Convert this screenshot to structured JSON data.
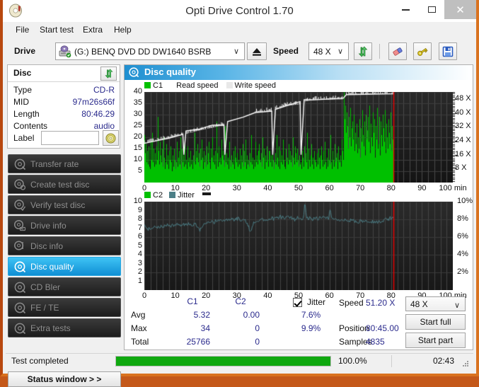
{
  "window": {
    "title": "Opti Drive Control 1.70",
    "icon": "disc-icon",
    "minimize_label": "–",
    "maximize_label": "□",
    "close_label": "✕"
  },
  "menu": {
    "items": [
      {
        "label": "File"
      },
      {
        "label": "Start test"
      },
      {
        "label": "Extra"
      },
      {
        "label": "Help"
      }
    ]
  },
  "toolbar": {
    "drive_label": "Drive",
    "drive_value": "(G:)   BENQ DVD DD DW1640 BSRB",
    "drive_icon": "drive-icon",
    "eject_icon": "eject-icon",
    "speed_label": "Speed",
    "speed_value": "48 X",
    "refresh_icon": "refresh-arrows-icon",
    "erase_icon": "erase-icon",
    "keys_icon": "keys-icon",
    "save_icon": "floppy-save-icon",
    "chevron": "∨"
  },
  "disc_panel": {
    "header": "Disc",
    "refresh_icon": "refresh-arrows-icon",
    "rows": [
      {
        "key": "Type",
        "value": "CD-R"
      },
      {
        "key": "MID",
        "value": "97m26s66f"
      },
      {
        "key": "Length",
        "value": "80:46.29"
      },
      {
        "key": "Contents",
        "value": "audio"
      }
    ],
    "label_key": "Label",
    "label_value": "",
    "label_placeholder": "",
    "label_button_icon": "cd-disc-icon"
  },
  "nav": {
    "items": [
      {
        "label": "Transfer rate",
        "icon": "disc-scan-icon",
        "active": false
      },
      {
        "label": "Create test disc",
        "icon": "disc-create-icon",
        "active": false
      },
      {
        "label": "Verify test disc",
        "icon": "disc-verify-icon",
        "active": false
      },
      {
        "label": "Drive info",
        "icon": "drive-info-icon",
        "active": false
      },
      {
        "label": "Disc info",
        "icon": "disc-info-icon",
        "active": false
      },
      {
        "label": "Disc quality",
        "icon": "disc-quality-icon",
        "active": true
      },
      {
        "label": "CD Bler",
        "icon": "disc-bler-icon",
        "active": false
      },
      {
        "label": "FE / TE",
        "icon": "disc-fete-icon",
        "active": false
      },
      {
        "label": "Extra tests",
        "icon": "disc-extra-icon",
        "active": false
      }
    ],
    "status_window_label": "Status window > >"
  },
  "content": {
    "title": "Disc quality",
    "icon": "disc-quality-icon"
  },
  "stats": {
    "col_headers": [
      "C1",
      "C2"
    ],
    "row_labels": [
      "Avg",
      "Max",
      "Total"
    ],
    "c1": {
      "avg": "5.32",
      "max": "34",
      "total": "25766"
    },
    "c2": {
      "avg": "0.00",
      "max": "0",
      "total": "0"
    },
    "jitter": {
      "label": "Jitter",
      "checked": true,
      "avg": "7.6%",
      "max": "9.9%"
    },
    "speed_label": "Speed",
    "speed_value": "51.20 X",
    "position_label": "Position",
    "position_value": "80:45.00",
    "samples_label": "Samples",
    "samples_value": "4835",
    "speed_select_value": "48 X",
    "start_full_label": "Start full",
    "start_part_label": "Start part"
  },
  "statusbar": {
    "status_text": "Test completed",
    "progress_pct": "100.0%",
    "progress_value": 100,
    "elapsed": "02:43"
  },
  "colors": {
    "c1_green": "#00c000",
    "jitter_teal": "#4c7f87",
    "speed_white": "#ffffff",
    "marker_red": "#ee0000",
    "plot_bg": "#202020",
    "accent_blue": "#1f8fd0",
    "progress_green": "#0fa80f"
  },
  "chart_data": [
    {
      "type": "area",
      "name": "c1-chart",
      "title": "",
      "xlabel": "min",
      "ylabel": "",
      "x": [
        0,
        100
      ],
      "xlim": [
        0,
        100
      ],
      "xticks": [
        0,
        10,
        20,
        30,
        40,
        50,
        60,
        70,
        80,
        90,
        100
      ],
      "xtick_labels": [
        "0",
        "10",
        "20",
        "30",
        "40",
        "50",
        "60",
        "70",
        "80",
        "90",
        "100 min"
      ],
      "ylim": [
        0,
        40
      ],
      "yticks": [
        5,
        10,
        15,
        20,
        25,
        30,
        35,
        40
      ],
      "ytick_labels": [
        "5",
        "10",
        "15",
        "20",
        "25",
        "30",
        "35",
        "40"
      ],
      "y2lim": [
        0,
        52
      ],
      "y2ticks": [
        8,
        16,
        24,
        32,
        40,
        48
      ],
      "y2tick_labels": [
        "8 X",
        "16 X",
        "24 X",
        "32 X",
        "40 X",
        "48 X"
      ],
      "grid": true,
      "legend": [
        {
          "label": "C1",
          "color": "#00c000"
        },
        {
          "label": "Read speed",
          "color": "#ffffff"
        },
        {
          "label": "Write speed",
          "color": "#e8e8e8"
        }
      ],
      "legend_position": "top-left",
      "data_end_x": 80.75,
      "marker_x": 80.75,
      "series": [
        {
          "name": "C1",
          "color": "#00c000",
          "kind": "impulse-area",
          "x_start": 0,
          "x_end": 80.75,
          "values": [
            21,
            13,
            17,
            9,
            14,
            8,
            16,
            7,
            12,
            6,
            18,
            10,
            22,
            9,
            15,
            7,
            11,
            13,
            8,
            16,
            10,
            29,
            14,
            8,
            18,
            6,
            12,
            9,
            15,
            7,
            20,
            11,
            6,
            13,
            9,
            17,
            8,
            12,
            6,
            14,
            10,
            8,
            16,
            9,
            5,
            12,
            7,
            15,
            10,
            6,
            13,
            9,
            18,
            7,
            11,
            14,
            8,
            20,
            10,
            6,
            15,
            9,
            12,
            7,
            17,
            8,
            13,
            10,
            6,
            16,
            9,
            11,
            7,
            14,
            8,
            19,
            10,
            6,
            12,
            9,
            22,
            8,
            14,
            6,
            11,
            17,
            9,
            13,
            7,
            15,
            10,
            8,
            19,
            11,
            6,
            14,
            9,
            12,
            7,
            16,
            10,
            8,
            13,
            18,
            9,
            6,
            15,
            11,
            7,
            20,
            9,
            12,
            8,
            14,
            6,
            27,
            10,
            13,
            7,
            16,
            9,
            11,
            8,
            19,
            12,
            6,
            14,
            10,
            7,
            25,
            9,
            13,
            8,
            15,
            11,
            6,
            18,
            10,
            7,
            12,
            9,
            22,
            8,
            14,
            6,
            16,
            11,
            9,
            13,
            7,
            20,
            10,
            8,
            15,
            6,
            12,
            9,
            17,
            11,
            7,
            14,
            9,
            19,
            6,
            12,
            8,
            16,
            10,
            7,
            13,
            9,
            21,
            8,
            11,
            6,
            15,
            10,
            7,
            18,
            9,
            12,
            8,
            14,
            6,
            17,
            10,
            9,
            13,
            7,
            20,
            11,
            8,
            15,
            6,
            12,
            9,
            16,
            10,
            7,
            14,
            26,
            14,
            9,
            12,
            7,
            18,
            10,
            6,
            15,
            9,
            13,
            8,
            21,
            11,
            7,
            16,
            10,
            6,
            14,
            9,
            12,
            8,
            19,
            10,
            7,
            13,
            6,
            15,
            9,
            11,
            8,
            17,
            10,
            6,
            14,
            9,
            12,
            7,
            20,
            11,
            8,
            16,
            6,
            13,
            9,
            15,
            10,
            7,
            12,
            8,
            18,
            9,
            6,
            14,
            11,
            7,
            16,
            10,
            8,
            13,
            9,
            22,
            6,
            15,
            10,
            7,
            12,
            9,
            17,
            8,
            11,
            6,
            14,
            10,
            9,
            19,
            7,
            13,
            8,
            15,
            11,
            6,
            12,
            9,
            16,
            10,
            7,
            14,
            8,
            18,
            9,
            6,
            13,
            11,
            7,
            15,
            10,
            8,
            21,
            9,
            12,
            6,
            14,
            10,
            7,
            17,
            9,
            11,
            8,
            13,
            6,
            16,
            10,
            9,
            12,
            7,
            19,
            8,
            14,
            10,
            42,
            28,
            34,
            22,
            31,
            18,
            25,
            15,
            29,
            20,
            33,
            16,
            24,
            12,
            27,
            19,
            30,
            14,
            22,
            17,
            26,
            13,
            31,
            20,
            15,
            28,
            11,
            24,
            18,
            32,
            14,
            21,
            16,
            27,
            12,
            30,
            19,
            23,
            15,
            29,
            18,
            34,
            13,
            26,
            20,
            16,
            31,
            14,
            22,
            28,
            11,
            25,
            19,
            33,
            15,
            23,
            17,
            29,
            12,
            27,
            21,
            16,
            30,
            14,
            24,
            18,
            32,
            13,
            26,
            20,
            15,
            28,
            11,
            22,
            17,
            31,
            14,
            25,
            19,
            29
          ]
        },
        {
          "name": "Read speed",
          "color": "#ffffff",
          "kind": "line",
          "unit": "X",
          "x_start": 0,
          "x_end": 80.75,
          "points": [
            {
              "x": 0,
              "speed": 22.5
            },
            {
              "x": 4,
              "speed": 24.0
            },
            {
              "x": 8,
              "speed": 25.5
            },
            {
              "x": 12.5,
              "speed": 27.5
            },
            {
              "x": 12.8,
              "speed": 16.0
            },
            {
              "x": 13.5,
              "speed": 28.0
            },
            {
              "x": 18,
              "speed": 30.0
            },
            {
              "x": 22,
              "speed": 31.5
            },
            {
              "x": 25.8,
              "speed": 33.0
            },
            {
              "x": 26.1,
              "speed": 16.0
            },
            {
              "x": 27,
              "speed": 35.0
            },
            {
              "x": 32,
              "speed": 37.5
            },
            {
              "x": 36,
              "speed": 40.5
            },
            {
              "x": 41.3,
              "speed": 41.0
            },
            {
              "x": 41.6,
              "speed": 16.0
            },
            {
              "x": 42.5,
              "speed": 42.0
            },
            {
              "x": 46,
              "speed": 44.0
            },
            {
              "x": 50.5,
              "speed": 45.0
            },
            {
              "x": 50.8,
              "speed": 16.0
            },
            {
              "x": 51.8,
              "speed": 46.5
            },
            {
              "x": 55,
              "speed": 47.5
            },
            {
              "x": 64.5,
              "speed": 47.8
            },
            {
              "x": 65.5,
              "speed": 50.5
            },
            {
              "x": 80.7,
              "speed": 51.2
            }
          ]
        }
      ]
    },
    {
      "type": "line",
      "name": "c2-jitter-chart",
      "title": "",
      "xlabel": "min",
      "ylabel": "",
      "xlim": [
        0,
        100
      ],
      "xticks": [
        0,
        10,
        20,
        30,
        40,
        50,
        60,
        70,
        80,
        90,
        100
      ],
      "xtick_labels": [
        "0",
        "10",
        "20",
        "30",
        "40",
        "50",
        "60",
        "70",
        "80",
        "90",
        "100 min"
      ],
      "ylim": [
        0,
        10
      ],
      "yticks": [
        1,
        2,
        3,
        4,
        5,
        6,
        7,
        8,
        9,
        10
      ],
      "ytick_labels": [
        "1",
        "2",
        "3",
        "4",
        "5",
        "6",
        "7",
        "8",
        "9",
        "10"
      ],
      "y2lim": [
        0,
        10
      ],
      "y2ticks": [
        2,
        4,
        6,
        8,
        10
      ],
      "y2tick_labels": [
        "2%",
        "4%",
        "6%",
        "8%",
        "10%"
      ],
      "grid": true,
      "legend": [
        {
          "label": "C2",
          "color": "#00c000"
        },
        {
          "label": "Jitter",
          "color": "#4c7f87"
        }
      ],
      "legend_position": "top-left",
      "data_end_x": 80.75,
      "marker_x": 80.75,
      "series": [
        {
          "name": "C2",
          "color": "#00c000",
          "kind": "impulse-area",
          "x_start": 0,
          "x_end": 80.75,
          "values": []
        },
        {
          "name": "Jitter",
          "color": "#4c7f87",
          "kind": "line",
          "unit": "%",
          "x_start": 0,
          "x_end": 80.75,
          "values": [
            7.3,
            7.0,
            6.8,
            6.9,
            7.0,
            6.9,
            7.1,
            7.0,
            7.2,
            7.0,
            7.1,
            7.2,
            7.1,
            7.3,
            7.2,
            7.1,
            7.3,
            7.2,
            7.4,
            7.2,
            7.3,
            7.2,
            7.4,
            7.3,
            7.2,
            7.4,
            7.5,
            7.3,
            7.4,
            7.3,
            7.5,
            7.4,
            7.3,
            7.5,
            7.4,
            7.6,
            7.4,
            7.5,
            7.3,
            7.4,
            7.6,
            7.4,
            7.2,
            7.0,
            6.6,
            7.0,
            7.3,
            7.5,
            7.4,
            7.6,
            7.5,
            7.7,
            7.5,
            7.6,
            7.8,
            7.6,
            7.7,
            7.9,
            7.7,
            7.8,
            8.0,
            7.8,
            7.9,
            8.1,
            7.9,
            8.0,
            7.8,
            8.1,
            7.9,
            8.0,
            8.2,
            8.0,
            7.9,
            8.1,
            8.0,
            8.2,
            8.0,
            7.9,
            8.1,
            8.0,
            7.9,
            7.7,
            7.5,
            7.2,
            6.5,
            6.8,
            7.2,
            7.6,
            7.8,
            7.7,
            7.9,
            7.8,
            8.0,
            7.9,
            8.1,
            7.9,
            8.0,
            7.8,
            8.0,
            7.9,
            8.1,
            8.0,
            8.2,
            8.0,
            8.1,
            8.3,
            8.1,
            8.2,
            8.4,
            8.2,
            8.3,
            8.1,
            8.2,
            8.4,
            8.2,
            8.3,
            8.1,
            8.2,
            8.0,
            8.1,
            7.9,
            8.0,
            8.2,
            8.0,
            8.1,
            7.9,
            8.0,
            8.2,
            10.0,
            8.4,
            8.1,
            8.0,
            8.2,
            8.0,
            7.9,
            8.1,
            8.0,
            8.2,
            8.0,
            8.1,
            8.3,
            8.1,
            8.2,
            8.4,
            8.2,
            8.0,
            8.3,
            8.1,
            9.2,
            8.3,
            8.1,
            8.0,
            7.9,
            8.1,
            7.9,
            8.0,
            7.8,
            7.9,
            8.1,
            7.9,
            8.0,
            7.8,
            7.9,
            7.7,
            7.8,
            8.0,
            7.8,
            7.9,
            7.7,
            7.8,
            7.6,
            7.7,
            7.9,
            7.7,
            7.8,
            7.6,
            7.7,
            7.9,
            7.7,
            7.8,
            7.6,
            7.7,
            7.8,
            7.6,
            7.7,
            7.9,
            7.7,
            7.8,
            7.6,
            7.7,
            7.9,
            7.8,
            7.9,
            8.1,
            7.9,
            8.0,
            8.2,
            8.0,
            8.1,
            8.3
          ]
        }
      ]
    }
  ]
}
